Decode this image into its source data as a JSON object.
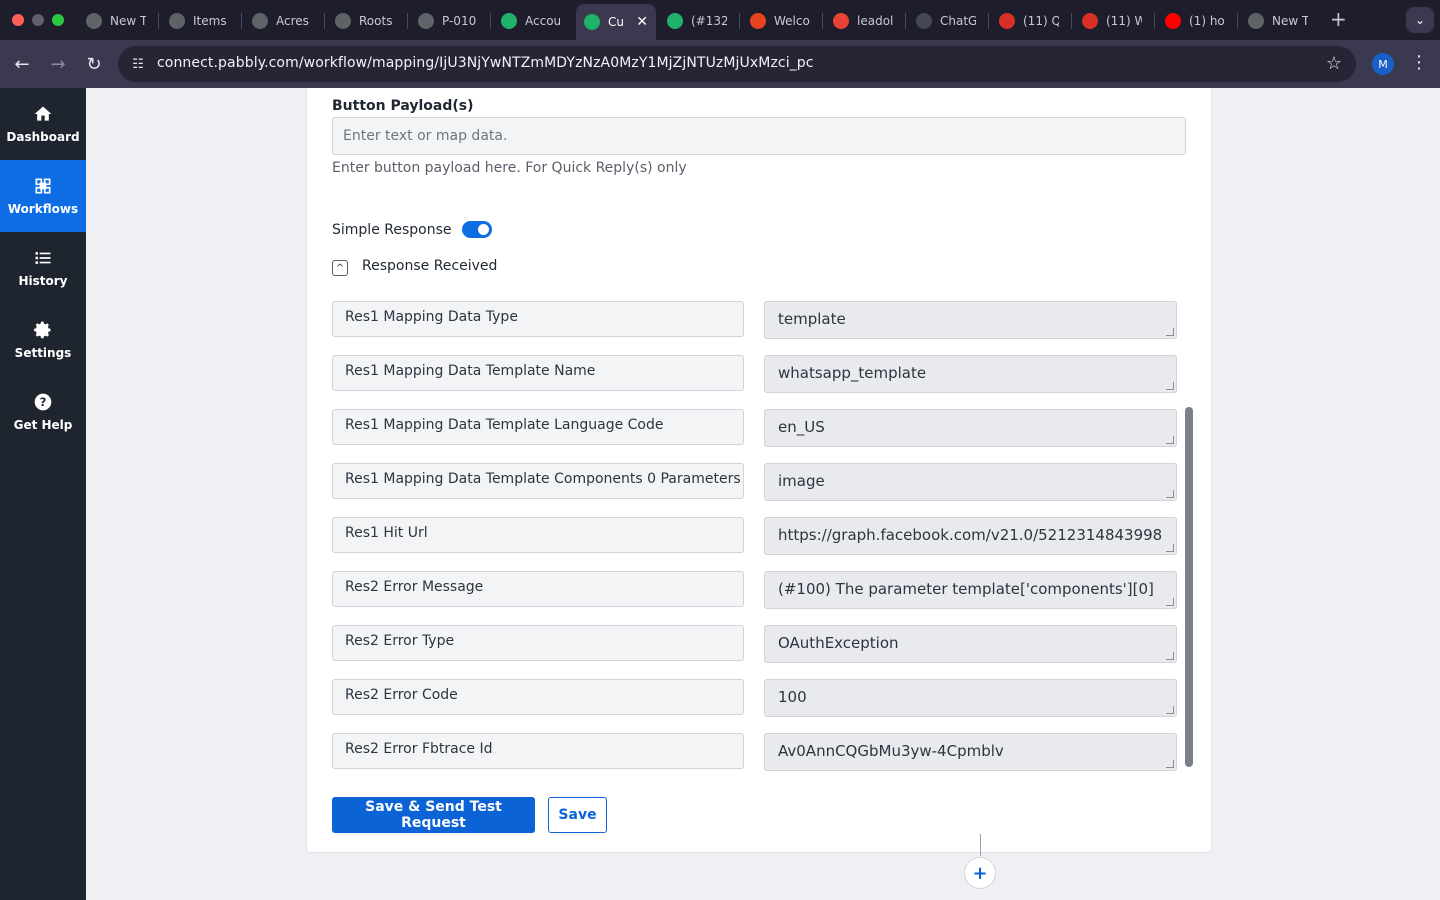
{
  "browser": {
    "tabs": [
      {
        "title": "New T",
        "icon": "chrome-icon",
        "color": "#5f6368"
      },
      {
        "title": "Items",
        "icon": "drive-icon",
        "color": "#5f6368"
      },
      {
        "title": "Acres",
        "icon": "drive-icon",
        "color": "#5f6368"
      },
      {
        "title": "Roots",
        "icon": "drive-icon",
        "color": "#5f6368"
      },
      {
        "title": "P-010",
        "icon": "globe-icon",
        "color": "#5f6368"
      },
      {
        "title": "Accou",
        "icon": "pabbly-icon",
        "color": "#20b26b"
      },
      {
        "title": "Cu",
        "icon": "pabbly-icon",
        "color": "#20b26b",
        "active": true
      },
      {
        "title": "(#132",
        "icon": "pabbly-icon",
        "color": "#20b26b"
      },
      {
        "title": "Welco",
        "icon": "m-icon",
        "color": "#e8431f"
      },
      {
        "title": "leadol",
        "icon": "gmail-icon",
        "color": "#ea4335"
      },
      {
        "title": "ChatG",
        "icon": "chatgpt-icon",
        "color": "#444654"
      },
      {
        "title": "(11) Q",
        "icon": "g-icon",
        "color": "#d93025"
      },
      {
        "title": "(11) W",
        "icon": "g-icon",
        "color": "#d93025"
      },
      {
        "title": "(1) ho",
        "icon": "youtube-icon",
        "color": "#ff0000"
      },
      {
        "title": "New T",
        "icon": "chrome-icon",
        "color": "#5f6368"
      }
    ],
    "url": "connect.pabbly.com/workflow/mapping/IjU3NjYwNTZmMDYzNzA0MzY1MjZjNTUzMjUxMzci_pc",
    "profile_initial": "M"
  },
  "sidebar": {
    "items": [
      {
        "label": "Dashboard",
        "icon": "home-icon"
      },
      {
        "label": "Workflows",
        "icon": "workflow-icon",
        "active": true
      },
      {
        "label": "History",
        "icon": "list-icon"
      },
      {
        "label": "Settings",
        "icon": "gear-icon"
      },
      {
        "label": "Get Help",
        "icon": "question-icon"
      }
    ]
  },
  "form": {
    "payload_label": "Button Payload(s)",
    "payload_placeholder": "Enter text or map data.",
    "payload_help": "Enter button payload here. For Quick Reply(s) only",
    "simple_response_label": "Simple Response",
    "simple_response_on": true,
    "response_received_label": "Response Received",
    "responses": [
      {
        "key": "Res1 Mapping Data Type",
        "value": "template"
      },
      {
        "key": "Res1 Mapping Data Template Name",
        "value": "whatsapp_template"
      },
      {
        "key": "Res1 Mapping Data Template Language Code",
        "value": "en_US"
      },
      {
        "key": "Res1 Mapping Data Template Components 0 Parameters",
        "value": "image"
      },
      {
        "key": "Res1 Hit Url",
        "value": "https://graph.facebook.com/v21.0/5212314843998"
      },
      {
        "key": "Res2 Error Message",
        "value": "(#100) The parameter template['components'][0]"
      },
      {
        "key": "Res2 Error Type",
        "value": "OAuthException"
      },
      {
        "key": "Res2 Error Code",
        "value": "100"
      },
      {
        "key": "Res2 Error Fbtrace Id",
        "value": "Av0AnnCQGbMu3yw-4Cpmblv"
      }
    ],
    "save_send_label": "Save & Send Test Request",
    "save_label": "Save"
  }
}
